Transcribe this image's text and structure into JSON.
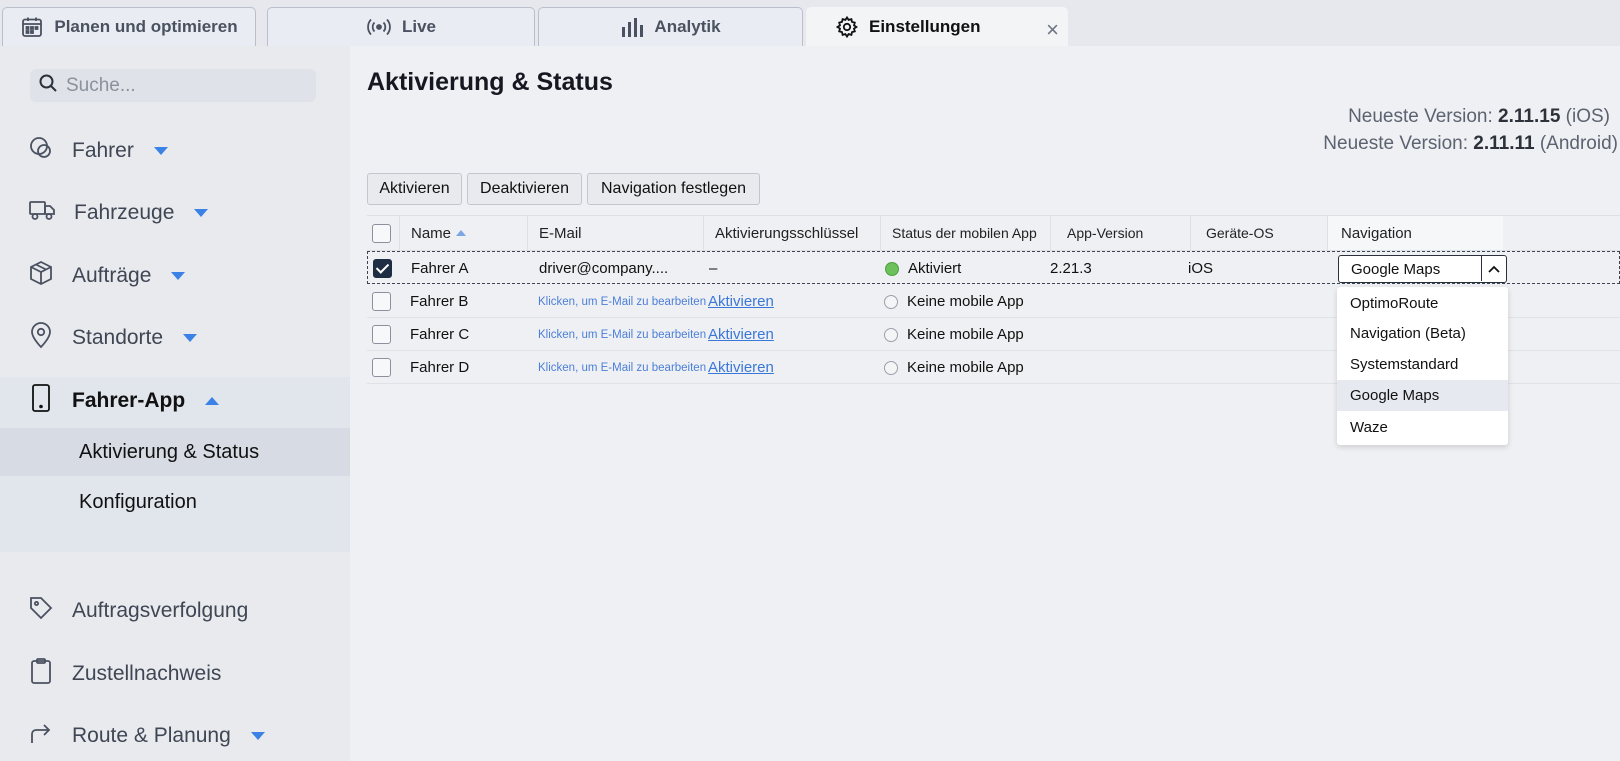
{
  "tabs": [
    {
      "label": "Planen und optimieren",
      "icon": "calendar-icon"
    },
    {
      "label": "Live",
      "icon": "broadcast-icon"
    },
    {
      "label": "Analytik",
      "icon": "bar-chart-icon"
    },
    {
      "label": "Einstellungen",
      "icon": "gear-icon",
      "active": true
    }
  ],
  "tab_close": "×",
  "sidebar": {
    "search_placeholder": "Suche...",
    "items": [
      {
        "label": "Fahrer",
        "icon": "drivers-icon"
      },
      {
        "label": "Fahrzeuge",
        "icon": "truck-icon"
      },
      {
        "label": "Aufträge",
        "icon": "package-icon"
      },
      {
        "label": "Standorte",
        "icon": "location-pin-icon"
      },
      {
        "label": "Fahrer-App",
        "icon": "phone-icon"
      },
      {
        "label": "Auftragsverfolgung",
        "icon": "tag-icon"
      },
      {
        "label": "Zustellnachweis",
        "icon": "clipboard-icon"
      },
      {
        "label": "Route & Planung",
        "icon": "route-arrow-icon"
      }
    ],
    "subitems": [
      {
        "label": "Aktivierung & Status",
        "selected": true
      },
      {
        "label": "Konfiguration"
      }
    ]
  },
  "main": {
    "title": "Aktivierung & Status",
    "version_ios_prefix": "Neueste Version:",
    "version_ios": "2.11.15",
    "version_ios_suffix": "(iOS)",
    "version_android_prefix": "Neueste Version:",
    "version_android": "2.11.11",
    "version_android_suffix": "(Android)",
    "buttons": {
      "activate": "Aktivieren",
      "deactivate": "Deaktivieren",
      "set_navigation": "Navigation festlegen"
    },
    "columns": {
      "name": "Name",
      "email": "E-Mail",
      "key": "Aktivierungsschlüssel",
      "status": "Status der mobilen App",
      "version": "App-Version",
      "os": "Geräte-OS",
      "navigation": "Navigation"
    },
    "rows": [
      {
        "name": "Fahrer A",
        "email": "driver@company....",
        "key": "–",
        "status": "Aktiviert",
        "version": "2.21.3",
        "os": "iOS",
        "checked": true
      },
      {
        "name": "Fahrer B",
        "email": "Klicken, um E-Mail zu bearbeiten",
        "key": "Aktivieren",
        "status": "Keine mobile App",
        "version": "",
        "os": "",
        "checked": false
      },
      {
        "name": "Fahrer C",
        "email": "Klicken, um E-Mail zu bearbeiten",
        "key": "Aktivieren",
        "status": "Keine mobile App",
        "version": "",
        "os": "",
        "checked": false
      },
      {
        "name": "Fahrer D",
        "email": "Klicken, um E-Mail zu bearbeiten",
        "key": "Aktivieren",
        "status": "Keine mobile App",
        "version": "",
        "os": "",
        "checked": false
      }
    ],
    "navigation_select": {
      "value": "Google Maps",
      "options": [
        "OptimoRoute",
        "Navigation (Beta)",
        "Systemstandard",
        "Google Maps",
        "Waze"
      ],
      "highlighted": "Google Maps"
    }
  },
  "colors": {
    "accent": "#3b82e6",
    "status_active": "#6cc15a",
    "link": "#3a78d8"
  }
}
